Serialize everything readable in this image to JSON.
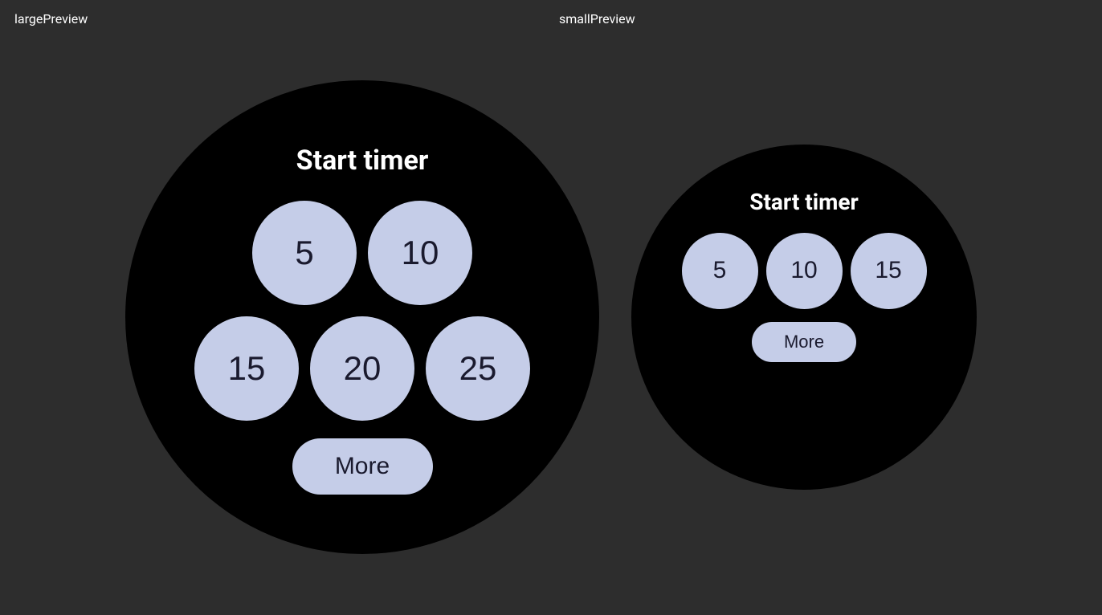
{
  "labels": {
    "large": "largePreview",
    "small": "smallPreview"
  },
  "large_preview": {
    "title": "Start timer",
    "row1": [
      "5",
      "10"
    ],
    "row2": [
      "15",
      "20",
      "25"
    ],
    "more": "More"
  },
  "small_preview": {
    "title": "Start timer",
    "row1": [
      "5",
      "10",
      "15"
    ],
    "more": "More"
  }
}
